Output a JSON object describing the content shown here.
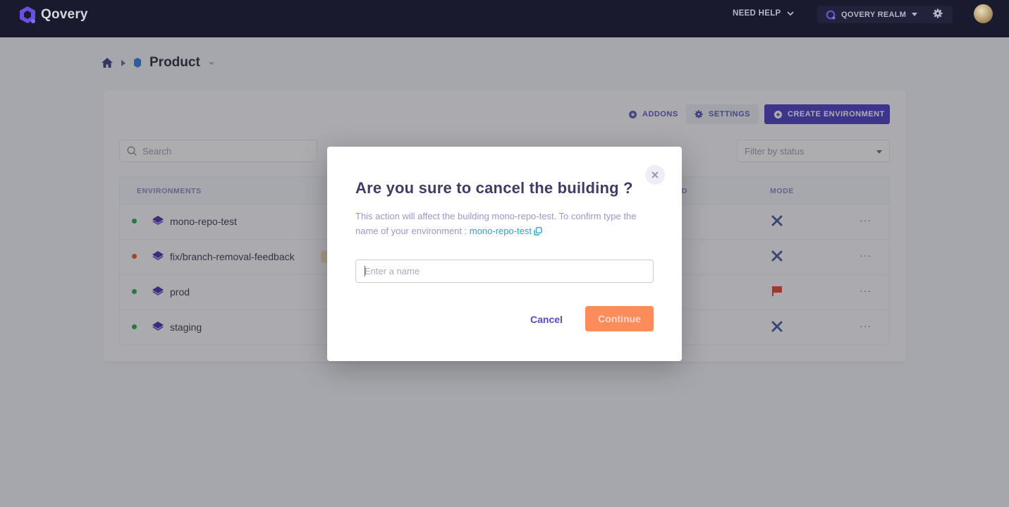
{
  "topbar": {
    "brand": "Qovery",
    "need_help": "NEED HELP",
    "organization": "QOVERY REALM"
  },
  "breadcrumb": {
    "project": "Product"
  },
  "toolbar": {
    "addons": "ADDONS",
    "settings": "SETTINGS",
    "create_environment": "CREATE ENVIRONMENT"
  },
  "filters": {
    "search_placeholder": "Search",
    "status_placeholder": "Filter by status"
  },
  "table": {
    "columns": {
      "environments": "ENVIRONMENTS",
      "partial_hidden": "ED",
      "mode": "MODE"
    },
    "rows": [
      {
        "name": "mono-repo-test",
        "status": "running",
        "status_color": "#22b14c",
        "mode": "development",
        "actions": "···"
      },
      {
        "name": "fix/branch-removal-feedback",
        "status": "error",
        "status_color": "#f0582c",
        "mode": "development",
        "actions": "···"
      },
      {
        "name": "prod",
        "status": "running",
        "status_color": "#22b14c",
        "mode": "production",
        "actions": "···"
      },
      {
        "name": "staging",
        "status": "running",
        "status_color": "#22b14c",
        "mode": "development",
        "actions": "···"
      }
    ]
  },
  "modal": {
    "title": "Are you sure to cancel the building ?",
    "description": "This action will affect the building mono-repo-test. To confirm type the name of your environment : ",
    "confirm_name": "mono-repo-test",
    "input_value": "",
    "input_placeholder": "Enter a name",
    "cancel_label": "Cancel",
    "continue_label": "Continue"
  },
  "colors": {
    "brand": "#4a3ec4",
    "topbar_bg": "#1a1a2e",
    "danger": "#fd8c5c",
    "link": "#2aa7bf",
    "mode_prod": "#e8452c",
    "mode_dev": "#4a5a9c"
  }
}
